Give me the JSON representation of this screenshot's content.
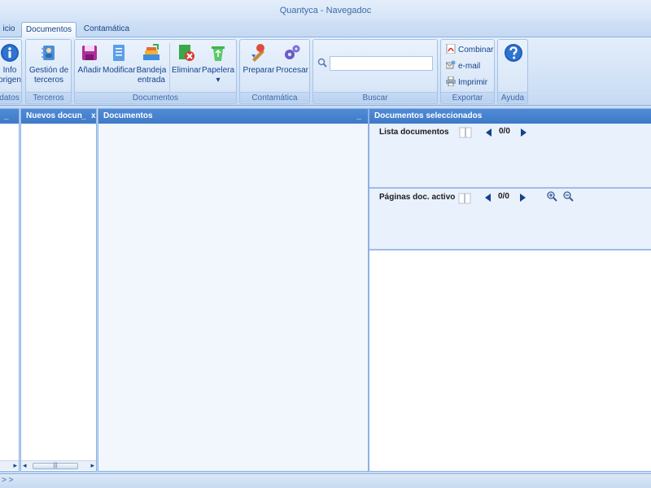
{
  "window": {
    "title": "Quantyca - Navegadoc"
  },
  "tabs": [
    {
      "label": "icio",
      "active": false
    },
    {
      "label": "Documentos",
      "active": true
    },
    {
      "label": "Contamática",
      "active": false
    }
  ],
  "ribbon": {
    "datos_group": {
      "label": "datos",
      "info_line1": "Info",
      "info_line2": "origen"
    },
    "terceros_group": {
      "label": "Terceros",
      "gestion_line1": "Gestión de",
      "gestion_line2": "terceros"
    },
    "documentos_group": {
      "label": "Documentos",
      "anadir": "Añadir",
      "modificar": "Modificar",
      "bandeja_line1": "Bandeja",
      "bandeja_line2": "entrada",
      "eliminar": "Eliminar",
      "papelera": "Papelera",
      "papelera_arrow": "▾"
    },
    "contamatica_group": {
      "label": "Contamática",
      "preparar": "Preparar",
      "procesar": "Procesar"
    },
    "buscar_group": {
      "label": "Buscar",
      "search_value": ""
    },
    "exportar_group": {
      "label": "Exportar",
      "combinar": "Combinar",
      "email": "e-mail",
      "imprimir": "Imprimir"
    },
    "ayuda_group": {
      "label": "Ayuda"
    }
  },
  "panels": {
    "left_header_ctrl": "_",
    "nuevos": {
      "title": "Nuevos docun",
      "min": "_",
      "close": "x"
    },
    "documentos": {
      "title": "Documentos",
      "min": "_"
    },
    "seleccionados": {
      "title": "Documentos seleccionados",
      "lista": {
        "label": "Lista documentos",
        "counter": "0/0"
      },
      "paginas": {
        "label": "Páginas doc. activo",
        "counter": "0/0"
      }
    }
  },
  "scrollbars": {
    "left_arrow": "◂",
    "right_arrow": "▸",
    "grip": "|||"
  },
  "statusbar": {
    "text": "> >"
  },
  "colors": {
    "header_blue": "#4a86d2",
    "ribbon_bg": "#dce9f8",
    "text_blue": "#15428b"
  }
}
